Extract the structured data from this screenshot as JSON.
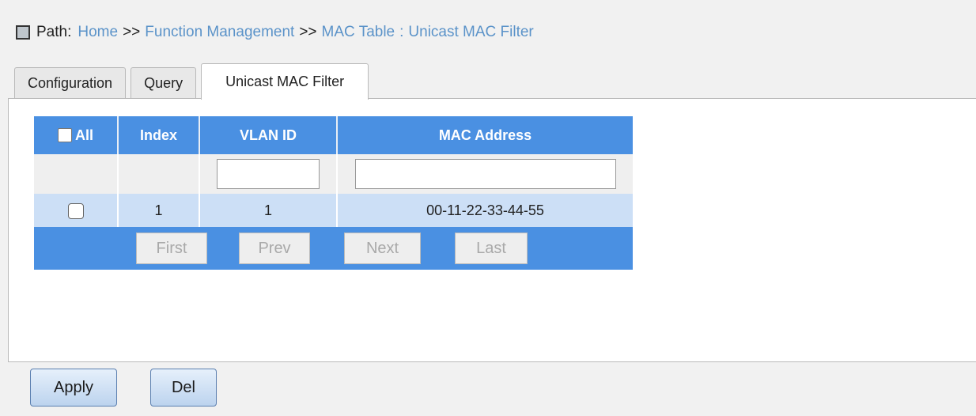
{
  "path": {
    "label": "Path:",
    "items": [
      "Home",
      "Function Management",
      "MAC Table",
      "Unicast MAC Filter"
    ],
    "sep1": ">>",
    "sep2": ">>",
    "sep3": ":"
  },
  "tabs": [
    {
      "label": "Configuration"
    },
    {
      "label": "Query"
    },
    {
      "label": "Unicast MAC Filter",
      "active": true
    }
  ],
  "table": {
    "headers": {
      "all": "All",
      "index": "Index",
      "vlan": "VLAN ID",
      "mac": "MAC Address"
    },
    "inputs": {
      "vlan": "",
      "mac": ""
    },
    "rows": [
      {
        "index": "1",
        "vlan": "1",
        "mac": "00-11-22-33-44-55"
      }
    ],
    "pager": {
      "first": "First",
      "prev": "Prev",
      "next": "Next",
      "last": "Last"
    }
  },
  "buttons": {
    "apply": "Apply",
    "del": "Del"
  },
  "colors": {
    "header": "#4a90e2",
    "row": "#ccdff6",
    "link": "#5b93c9"
  }
}
